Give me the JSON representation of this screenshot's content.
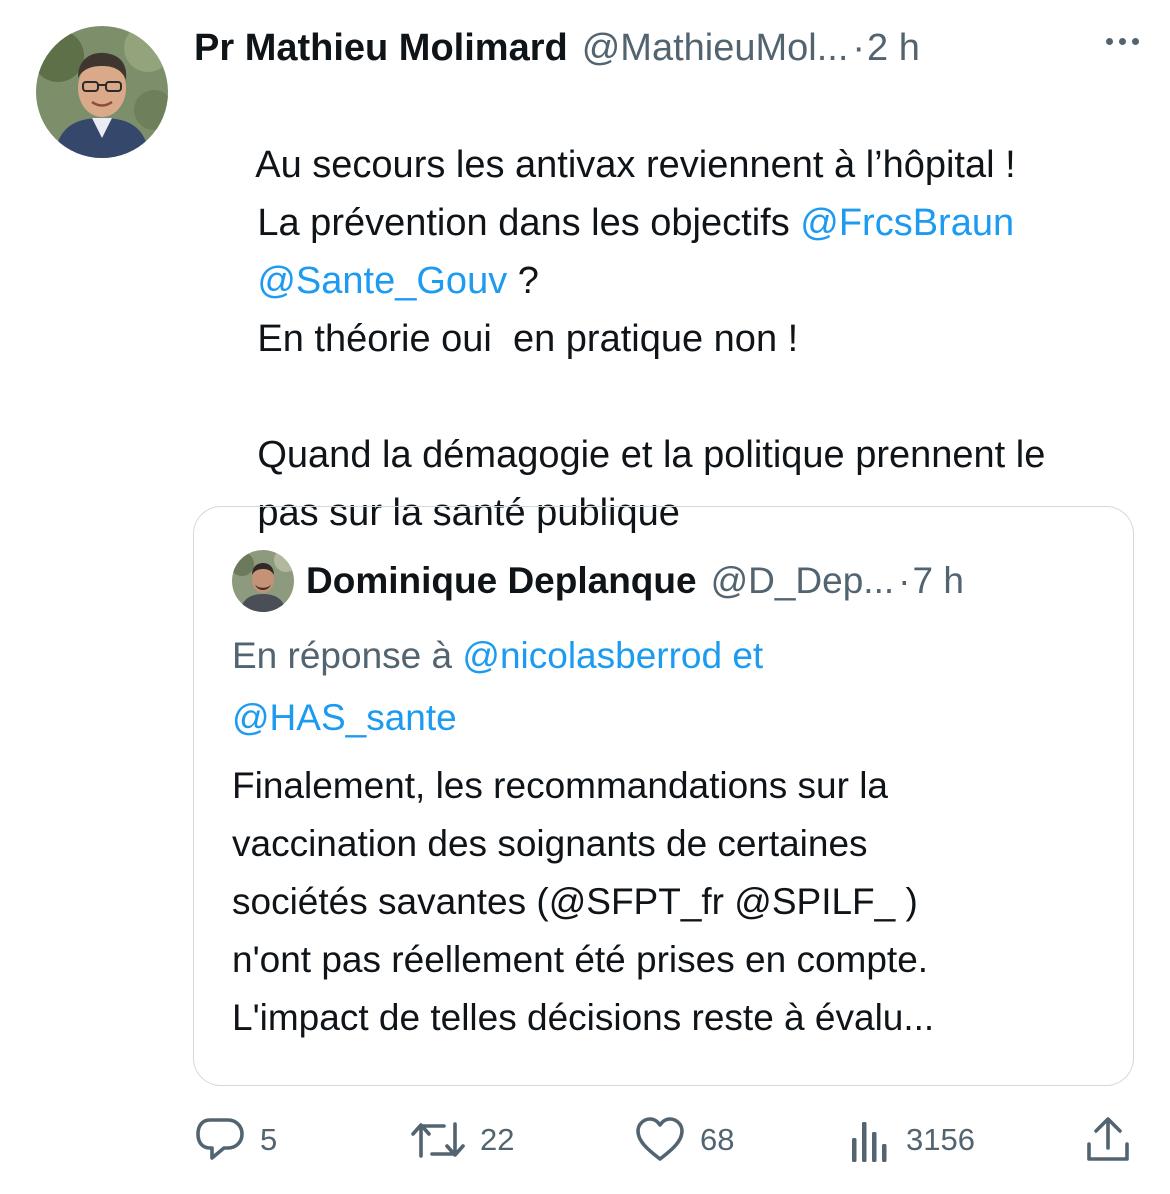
{
  "tweet": {
    "author_name": "Pr Mathieu Molimard",
    "author_handle": "@MathieuMol...",
    "separator": "·",
    "time": "2 h",
    "lines": [
      [
        {
          "text": "Au secours les antivax reviennent à l’hôpital !",
          "mention": false
        }
      ],
      [
        {
          "text": "La prévention dans les objectifs ",
          "mention": false
        },
        {
          "text": "@FrcsBraun",
          "mention": true
        }
      ],
      [
        {
          "text": "@Sante_Gouv",
          "mention": true
        },
        {
          "text": " ?",
          "mention": false
        }
      ],
      [
        {
          "text": "En théorie oui  en pratique non !",
          "mention": false
        }
      ],
      [
        {
          "text": "",
          "mention": false
        }
      ],
      [
        {
          "text": "Quand la démagogie et la politique prennent le",
          "mention": false
        }
      ],
      [
        {
          "text": "pas sur la santé publique",
          "mention": false
        }
      ]
    ]
  },
  "quote": {
    "author_name": "Dominique Deplanque",
    "author_handle": "@D_Dep...",
    "separator": "·",
    "time": "7 h",
    "reply_prefix": "En réponse à ",
    "reply_mention_1": "@nicolasberrod",
    "reply_joiner": " et",
    "reply_mention_2": "@HAS_sante",
    "lines": [
      "Finalement, les recommandations sur la",
      "vaccination des soignants de certaines",
      "sociétés savantes (@SFPT_fr @SPILF_ )",
      "n'ont pas réellement été prises en compte.",
      "L'impact de telles décisions reste à évalu..."
    ]
  },
  "actions": {
    "replies": "5",
    "retweets": "22",
    "likes": "68",
    "views": "3156"
  },
  "icons": {
    "reply": "reply-icon",
    "retweet": "retweet-icon",
    "like": "heart-icon",
    "views": "views-icon",
    "share": "share-icon",
    "more": "more-icon"
  },
  "colors": {
    "link": "#1d9bf0",
    "secondary": "#536471",
    "text": "#0f1419",
    "border": "#cfd9de"
  }
}
